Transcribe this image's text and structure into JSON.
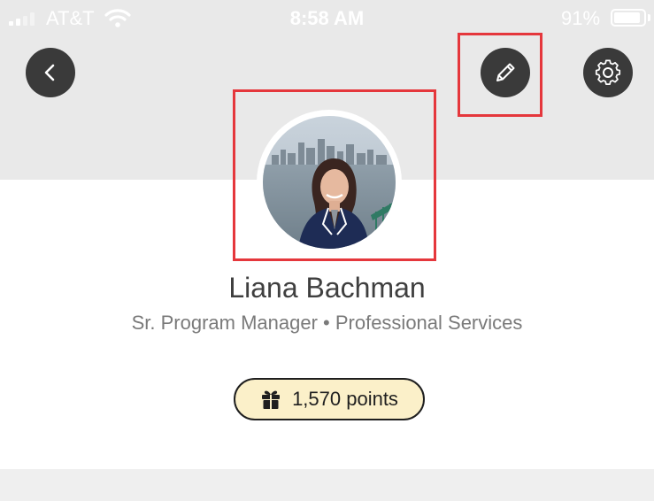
{
  "status_bar": {
    "carrier": "AT&T",
    "time": "8:58 AM",
    "battery_percent": "91%",
    "battery_level": 0.91,
    "wifi_icon": "wifi-icon",
    "signal_icon": "cellular-signal-icon"
  },
  "header": {
    "back_icon": "chevron-left-icon",
    "edit_icon": "pencil-icon",
    "settings_icon": "gear-icon"
  },
  "profile": {
    "name": "Liana Bachman",
    "subtitle": "Sr. Program Manager • Professional Services",
    "points_label": "1,570 points",
    "points_icon": "gift-icon"
  },
  "colors": {
    "header_background": "#e9e9e9",
    "button_background": "#3a3a3a",
    "highlight_border": "#e5373c",
    "points_badge_background": "#fbf0c9"
  }
}
